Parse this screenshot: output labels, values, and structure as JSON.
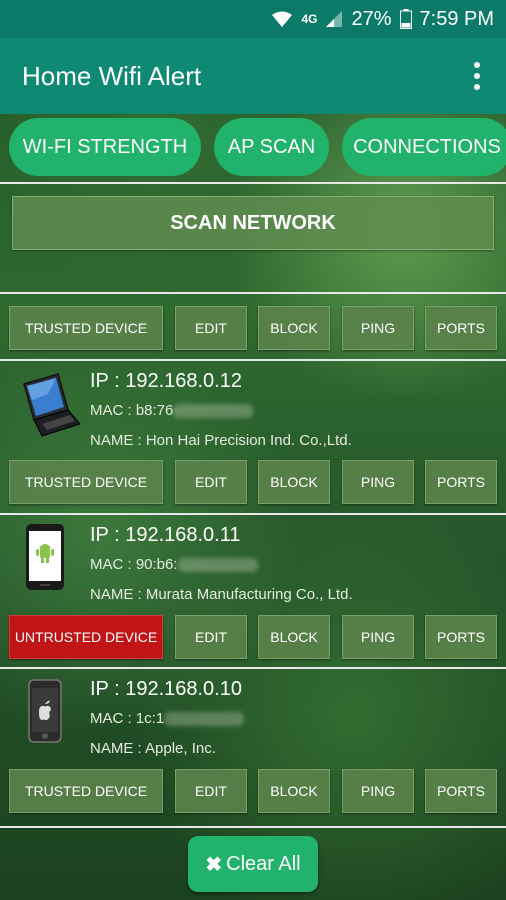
{
  "statusbar": {
    "network": "4G",
    "battery": "27%",
    "time": "7:59 PM"
  },
  "appbar": {
    "title": "Home Wifi Alert",
    "menu_icon": "overflow-menu-icon"
  },
  "tabs": [
    {
      "label": "WI-FI STRENGTH"
    },
    {
      "label": "AP SCAN"
    },
    {
      "label": "CONNECTIONS"
    }
  ],
  "scan_button": "SCAN NETWORK",
  "header_actions": {
    "trust": "TRUSTED DEVICE",
    "edit": "EDIT",
    "block": "BLOCK",
    "ping": "PING",
    "ports": "PORTS"
  },
  "devices": [
    {
      "icon": "laptop-icon",
      "ip": "IP : 192.168.0.12",
      "mac": "MAC : b8:76",
      "name": "NAME : Hon Hai Precision Ind. Co.,Ltd.",
      "trust_label": "TRUSTED DEVICE",
      "trusted": true
    },
    {
      "icon": "android-phone-icon",
      "ip": "IP : 192.168.0.11",
      "mac": "MAC : 90:b6:",
      "name": "NAME : Murata Manufacturing Co., Ltd.",
      "trust_label": "UNTRUSTED DEVICE",
      "trusted": false
    },
    {
      "icon": "iphone-icon",
      "ip": "IP : 192.168.0.10",
      "mac": "MAC : 1c:1",
      "name": "NAME : Apple, Inc.",
      "trust_label": "TRUSTED DEVICE",
      "trusted": true
    }
  ],
  "actions": {
    "edit": "EDIT",
    "block": "BLOCK",
    "ping": "PING",
    "ports": "PORTS"
  },
  "clear_all": "Clear All",
  "colors": {
    "statusbar": "#0c7a68",
    "appbar": "#0e8a74",
    "tab": "#21b36b",
    "untrusted": "#c01416"
  }
}
